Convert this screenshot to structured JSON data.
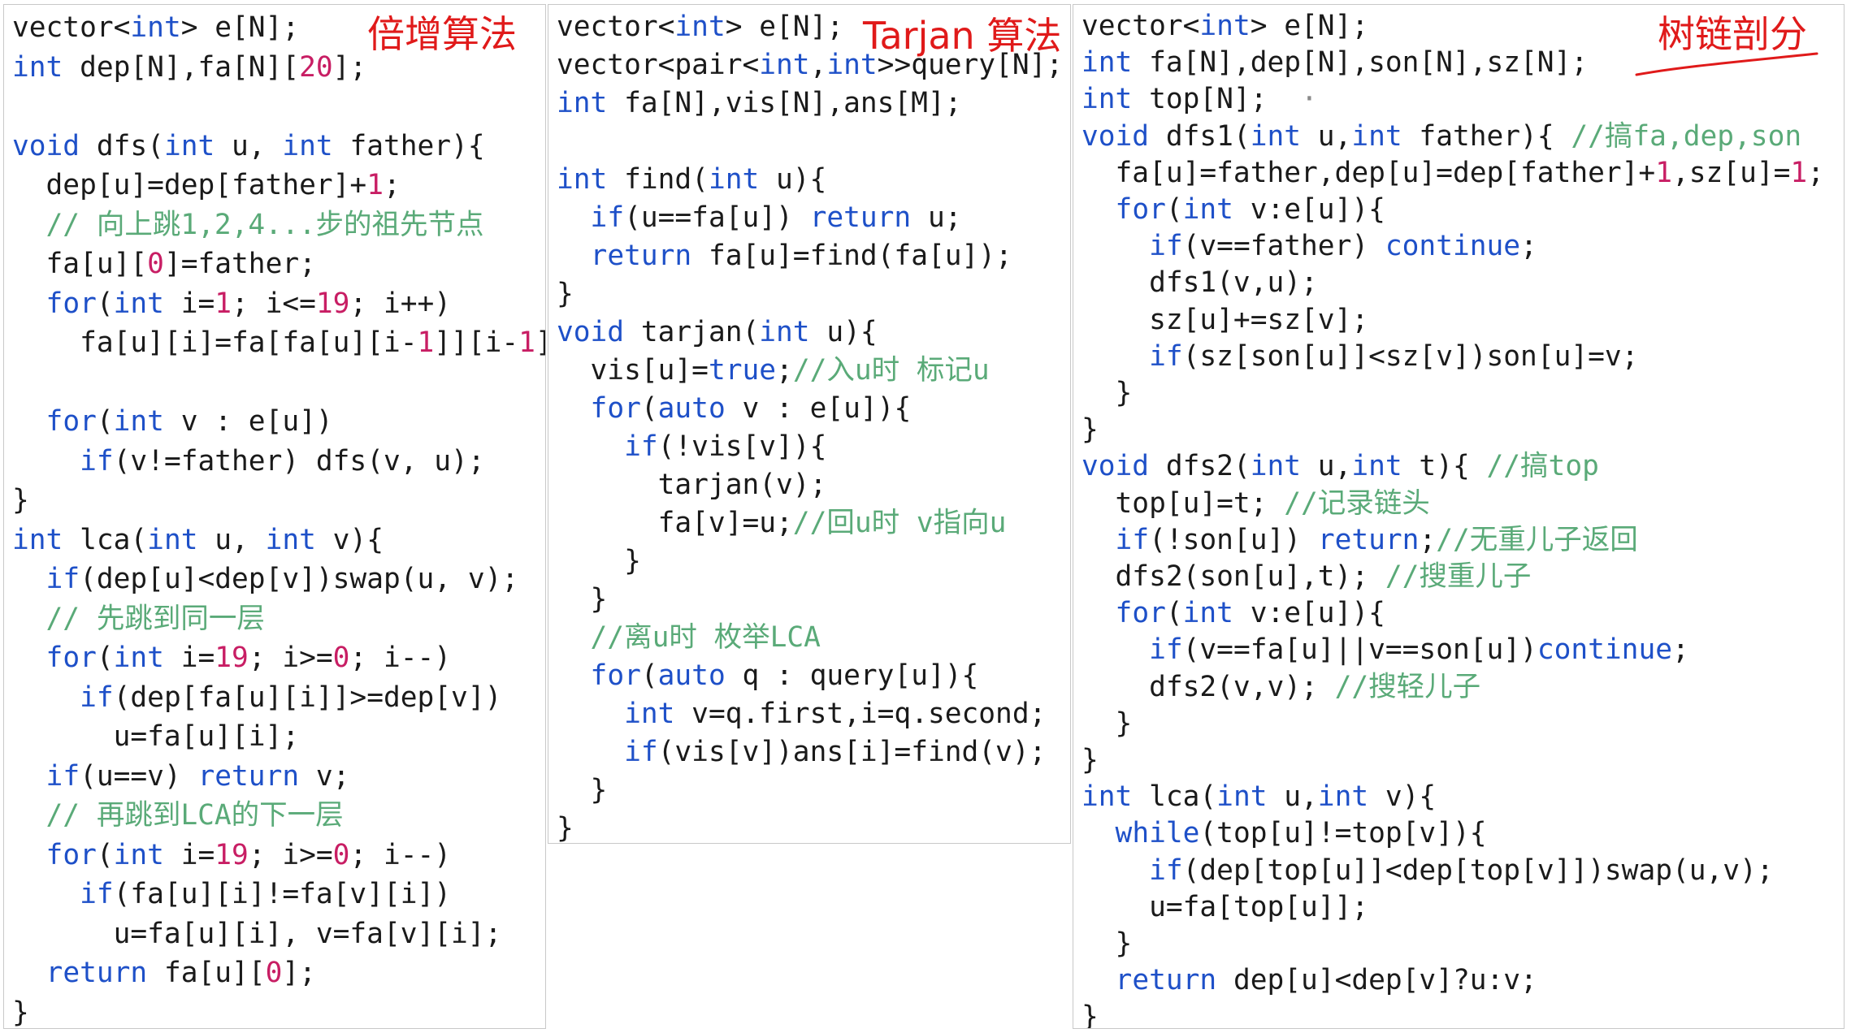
{
  "titles": {
    "doubling": "倍增算法",
    "tarjan": "Tarjan 算法",
    "hld": "树链剖分"
  },
  "colors": {
    "keyword": "#1e50c8",
    "number": "#c81e64",
    "comment": "#5aaa78",
    "title": "#e01a1a"
  },
  "panels": {
    "doubling": [
      [
        [
          "vector<",
          "t"
        ],
        [
          "int",
          "k"
        ],
        [
          "> e[N];",
          "t"
        ]
      ],
      [
        [
          "int",
          "k"
        ],
        [
          " dep[N],fa[N][",
          "t"
        ],
        [
          "20",
          "n"
        ],
        [
          "];",
          "t"
        ]
      ],
      [
        [
          "",
          ""
        ]
      ],
      [
        [
          "void",
          "k"
        ],
        [
          " dfs(",
          "t"
        ],
        [
          "int",
          "k"
        ],
        [
          " u, ",
          "t"
        ],
        [
          "int",
          "k"
        ],
        [
          " father){",
          "t"
        ]
      ],
      [
        [
          "  dep[u]=dep[father]+",
          "t"
        ],
        [
          "1",
          "n"
        ],
        [
          ";",
          "t"
        ]
      ],
      [
        [
          "  // 向上跳1,2,4...步的祖先节点",
          "c"
        ]
      ],
      [
        [
          "  fa[u][",
          "t"
        ],
        [
          "0",
          "n"
        ],
        [
          "]=father;",
          "t"
        ]
      ],
      [
        [
          "  ",
          "t"
        ],
        [
          "for",
          "k"
        ],
        [
          "(",
          "t"
        ],
        [
          "int",
          "k"
        ],
        [
          " i=",
          "t"
        ],
        [
          "1",
          "n"
        ],
        [
          "; i<=",
          "t"
        ],
        [
          "19",
          "n"
        ],
        [
          "; i++)",
          "t"
        ]
      ],
      [
        [
          "    fa[u][i]=fa[fa[u][i-",
          "t"
        ],
        [
          "1",
          "n"
        ],
        [
          "]][i-",
          "t"
        ],
        [
          "1",
          "n"
        ],
        [
          "];",
          "t"
        ]
      ],
      [
        [
          "",
          ""
        ]
      ],
      [
        [
          "  ",
          "t"
        ],
        [
          "for",
          "k"
        ],
        [
          "(",
          "t"
        ],
        [
          "int",
          "k"
        ],
        [
          " v : e[u])",
          "t"
        ]
      ],
      [
        [
          "    ",
          "t"
        ],
        [
          "if",
          "k"
        ],
        [
          "(v!=father) dfs(v, u);",
          "t"
        ]
      ],
      [
        [
          "}",
          "t"
        ]
      ],
      [
        [
          "int",
          "k"
        ],
        [
          " lca(",
          "t"
        ],
        [
          "int",
          "k"
        ],
        [
          " u, ",
          "t"
        ],
        [
          "int",
          "k"
        ],
        [
          " v){",
          "t"
        ]
      ],
      [
        [
          "  ",
          "t"
        ],
        [
          "if",
          "k"
        ],
        [
          "(dep[u]<dep[v])swap(u, v);",
          "t"
        ]
      ],
      [
        [
          "  // 先跳到同一层",
          "c"
        ]
      ],
      [
        [
          "  ",
          "t"
        ],
        [
          "for",
          "k"
        ],
        [
          "(",
          "t"
        ],
        [
          "int",
          "k"
        ],
        [
          " i=",
          "t"
        ],
        [
          "19",
          "n"
        ],
        [
          "; i>=",
          "t"
        ],
        [
          "0",
          "n"
        ],
        [
          "; i--)",
          "t"
        ]
      ],
      [
        [
          "    ",
          "t"
        ],
        [
          "if",
          "k"
        ],
        [
          "(dep[fa[u][i]]>=dep[v])",
          "t"
        ]
      ],
      [
        [
          "      u=fa[u][i];",
          "t"
        ]
      ],
      [
        [
          "  ",
          "t"
        ],
        [
          "if",
          "k"
        ],
        [
          "(u==v) ",
          "t"
        ],
        [
          "return",
          "k"
        ],
        [
          " v;",
          "t"
        ]
      ],
      [
        [
          "  // 再跳到LCA的下一层",
          "c"
        ]
      ],
      [
        [
          "  ",
          "t"
        ],
        [
          "for",
          "k"
        ],
        [
          "(",
          "t"
        ],
        [
          "int",
          "k"
        ],
        [
          " i=",
          "t"
        ],
        [
          "19",
          "n"
        ],
        [
          "; i>=",
          "t"
        ],
        [
          "0",
          "n"
        ],
        [
          "; i--)",
          "t"
        ]
      ],
      [
        [
          "    ",
          "t"
        ],
        [
          "if",
          "k"
        ],
        [
          "(fa[u][i]!=fa[v][i])",
          "t"
        ]
      ],
      [
        [
          "      u=fa[u][i], v=fa[v][i];",
          "t"
        ]
      ],
      [
        [
          "  ",
          "t"
        ],
        [
          "return",
          "k"
        ],
        [
          " fa[u][",
          "t"
        ],
        [
          "0",
          "n"
        ],
        [
          "];",
          "t"
        ]
      ],
      [
        [
          "}",
          "t"
        ]
      ]
    ],
    "tarjan": [
      [
        [
          "vector<",
          "t"
        ],
        [
          "int",
          "k"
        ],
        [
          "> e[N];",
          "t"
        ]
      ],
      [
        [
          "vector<pair<",
          "t"
        ],
        [
          "int",
          "k"
        ],
        [
          ",",
          "t"
        ],
        [
          "int",
          "k"
        ],
        [
          ">>query[N];",
          "t"
        ]
      ],
      [
        [
          "int",
          "k"
        ],
        [
          " fa[N],vis[N],ans[M];",
          "t"
        ]
      ],
      [
        [
          "",
          ""
        ]
      ],
      [
        [
          "int",
          "k"
        ],
        [
          " find(",
          "t"
        ],
        [
          "int",
          "k"
        ],
        [
          " u){",
          "t"
        ]
      ],
      [
        [
          "  ",
          "t"
        ],
        [
          "if",
          "k"
        ],
        [
          "(u==fa[u]) ",
          "t"
        ],
        [
          "return",
          "k"
        ],
        [
          " u;",
          "t"
        ]
      ],
      [
        [
          "  ",
          "t"
        ],
        [
          "return",
          "k"
        ],
        [
          " fa[u]=find(fa[u]);",
          "t"
        ]
      ],
      [
        [
          "}",
          "t"
        ]
      ],
      [
        [
          "void",
          "k"
        ],
        [
          " tarjan(",
          "t"
        ],
        [
          "int",
          "k"
        ],
        [
          " u){",
          "t"
        ]
      ],
      [
        [
          "  vis[u]=",
          "t"
        ],
        [
          "true",
          "k"
        ],
        [
          ";",
          "t"
        ],
        [
          "//入u时 标记u",
          "c"
        ]
      ],
      [
        [
          "  ",
          "t"
        ],
        [
          "for",
          "k"
        ],
        [
          "(",
          "t"
        ],
        [
          "auto",
          "k"
        ],
        [
          " v : e[u]){",
          "t"
        ]
      ],
      [
        [
          "    ",
          "t"
        ],
        [
          "if",
          "k"
        ],
        [
          "(!vis[v]){",
          "t"
        ]
      ],
      [
        [
          "      tarjan(v);",
          "t"
        ]
      ],
      [
        [
          "      fa[v]=u;",
          "t"
        ],
        [
          "//回u时 v指向u",
          "c"
        ]
      ],
      [
        [
          "    }",
          "t"
        ]
      ],
      [
        [
          "  }",
          "t"
        ]
      ],
      [
        [
          "  //离u时 枚举LCA",
          "c"
        ]
      ],
      [
        [
          "  ",
          "t"
        ],
        [
          "for",
          "k"
        ],
        [
          "(",
          "t"
        ],
        [
          "auto",
          "k"
        ],
        [
          " q : query[u]){",
          "t"
        ]
      ],
      [
        [
          "    ",
          "t"
        ],
        [
          "int",
          "k"
        ],
        [
          " v=q.first,i=q.second;",
          "t"
        ]
      ],
      [
        [
          "    ",
          "t"
        ],
        [
          "if",
          "k"
        ],
        [
          "(vis[v])ans[i]=find(v);",
          "t"
        ]
      ],
      [
        [
          "  }",
          "t"
        ]
      ],
      [
        [
          "}",
          "t"
        ]
      ]
    ],
    "hld": [
      [
        [
          "vector<",
          "t"
        ],
        [
          "int",
          "k"
        ],
        [
          "> e[N];",
          "t"
        ]
      ],
      [
        [
          "int",
          "k"
        ],
        [
          " fa[N],dep[N],son[N],sz[N];",
          "t"
        ]
      ],
      [
        [
          "int",
          "k"
        ],
        [
          " top[N];  ",
          "t"
        ],
        [
          "·",
          "o"
        ]
      ],
      [
        [
          "void",
          "k"
        ],
        [
          " dfs1(",
          "t"
        ],
        [
          "int",
          "k"
        ],
        [
          " u,",
          "t"
        ],
        [
          "int",
          "k"
        ],
        [
          " father){ ",
          "t"
        ],
        [
          "//搞fa,dep,son",
          "c"
        ]
      ],
      [
        [
          "  fa[u]=father,dep[u]=dep[father]+",
          "t"
        ],
        [
          "1",
          "n"
        ],
        [
          ",sz[u]=",
          "t"
        ],
        [
          "1",
          "n"
        ],
        [
          ";",
          "t"
        ]
      ],
      [
        [
          "  ",
          "t"
        ],
        [
          "for",
          "k"
        ],
        [
          "(",
          "t"
        ],
        [
          "int",
          "k"
        ],
        [
          " v:e[u]){",
          "t"
        ]
      ],
      [
        [
          "    ",
          "t"
        ],
        [
          "if",
          "k"
        ],
        [
          "(v==father) ",
          "t"
        ],
        [
          "continue",
          "k"
        ],
        [
          ";",
          "t"
        ]
      ],
      [
        [
          "    dfs1(v,u);",
          "t"
        ]
      ],
      [
        [
          "    sz[u]+=sz[v];",
          "t"
        ]
      ],
      [
        [
          "    ",
          "t"
        ],
        [
          "if",
          "k"
        ],
        [
          "(sz[son[u]]<sz[v])son[u]=v;",
          "t"
        ]
      ],
      [
        [
          "  }",
          "t"
        ]
      ],
      [
        [
          "}",
          "t"
        ]
      ],
      [
        [
          "void",
          "k"
        ],
        [
          " dfs2(",
          "t"
        ],
        [
          "int",
          "k"
        ],
        [
          " u,",
          "t"
        ],
        [
          "int",
          "k"
        ],
        [
          " t){ ",
          "t"
        ],
        [
          "//搞top",
          "c"
        ]
      ],
      [
        [
          "  top[u]=t; ",
          "t"
        ],
        [
          "//记录链头",
          "c"
        ]
      ],
      [
        [
          "  ",
          "t"
        ],
        [
          "if",
          "k"
        ],
        [
          "(!son[u]) ",
          "t"
        ],
        [
          "return",
          "k"
        ],
        [
          ";",
          "t"
        ],
        [
          "//无重儿子返回",
          "c"
        ]
      ],
      [
        [
          "  dfs2(son[u],t); ",
          "t"
        ],
        [
          "//搜重儿子",
          "c"
        ]
      ],
      [
        [
          "  ",
          "t"
        ],
        [
          "for",
          "k"
        ],
        [
          "(",
          "t"
        ],
        [
          "int",
          "k"
        ],
        [
          " v:e[u]){",
          "t"
        ]
      ],
      [
        [
          "    ",
          "t"
        ],
        [
          "if",
          "k"
        ],
        [
          "(v==fa[u]||v==son[u])",
          "t"
        ],
        [
          "continue",
          "k"
        ],
        [
          ";",
          "t"
        ]
      ],
      [
        [
          "    dfs2(v,v); ",
          "t"
        ],
        [
          "//搜轻儿子",
          "c"
        ]
      ],
      [
        [
          "  }",
          "t"
        ]
      ],
      [
        [
          "}",
          "t"
        ]
      ],
      [
        [
          "int",
          "k"
        ],
        [
          " lca(",
          "t"
        ],
        [
          "int",
          "k"
        ],
        [
          " u,",
          "t"
        ],
        [
          "int",
          "k"
        ],
        [
          " v){",
          "t"
        ]
      ],
      [
        [
          "  ",
          "t"
        ],
        [
          "while",
          "k"
        ],
        [
          "(top[u]!=top[v]){",
          "t"
        ]
      ],
      [
        [
          "    ",
          "t"
        ],
        [
          "if",
          "k"
        ],
        [
          "(dep[top[u]]<dep[top[v]])swap(u,v);",
          "t"
        ]
      ],
      [
        [
          "    u=fa[top[u]];",
          "t"
        ]
      ],
      [
        [
          "  }",
          "t"
        ]
      ],
      [
        [
          "  ",
          "t"
        ],
        [
          "return",
          "k"
        ],
        [
          " dep[u]<dep[v]?u:v;",
          "t"
        ]
      ],
      [
        [
          "}",
          "t"
        ]
      ]
    ]
  }
}
